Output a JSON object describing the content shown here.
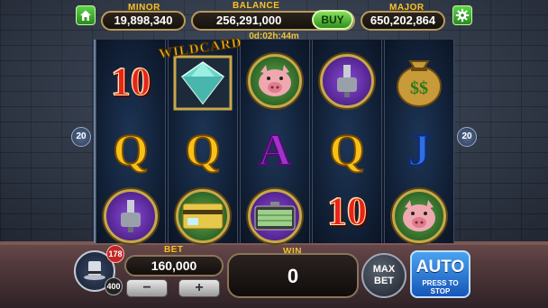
{
  "jackpots": {
    "minor": {
      "label": "MINOR",
      "value": "19,898,340"
    },
    "balance": {
      "label": "BALANCE",
      "value": "256,291,000"
    },
    "major": {
      "label": "MAJOR",
      "value": "650,202,864"
    }
  },
  "buy_label": "BUY",
  "timer": "0d:02h:44m",
  "icons": {
    "home": "home-icon",
    "settings": "gear-icon"
  },
  "paylines": {
    "left": "20",
    "right": "20"
  },
  "wildcard_label": "WILDCARD",
  "reels": [
    [
      "10",
      "Q",
      "drill"
    ],
    [
      "diamond-wild",
      "Q",
      "bank-card"
    ],
    [
      "pig",
      "A",
      "cash-case"
    ],
    [
      "drill",
      "Q",
      "10"
    ],
    [
      "money-bag",
      "J",
      "pig"
    ]
  ],
  "player": {
    "level": "178",
    "level_target": "400"
  },
  "bet": {
    "label": "BET",
    "value": "160,000",
    "decrease": "−",
    "increase": "+"
  },
  "win": {
    "label": "WIN",
    "value": "0"
  },
  "max_bet": {
    "line1": "MAX",
    "line2": "BET"
  },
  "auto": {
    "label": "AUTO",
    "sub": "PRESS TO STOP"
  },
  "colors": {
    "gold": "#f4c232",
    "buy_green": "#2e8f1f",
    "auto_blue": "#1656b8"
  }
}
